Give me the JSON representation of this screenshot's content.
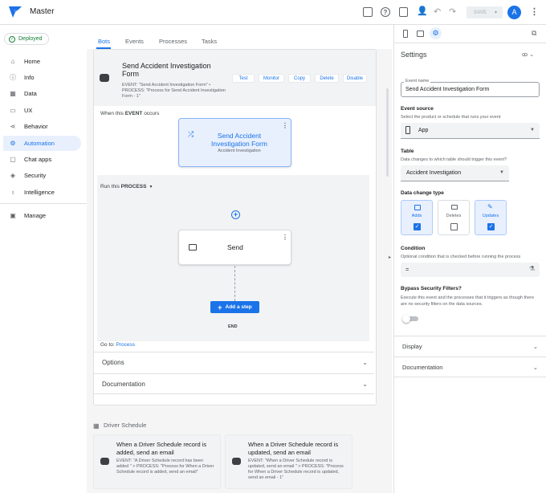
{
  "app": {
    "title": "Master",
    "save_label": "SAVE",
    "avatar_letter": "A"
  },
  "sidebar": {
    "deployed_label": "Deployed",
    "items": [
      {
        "label": "Home",
        "icon": "home-icon"
      },
      {
        "label": "Info",
        "icon": "info-icon"
      },
      {
        "label": "Data",
        "icon": "data-icon"
      },
      {
        "label": "UX",
        "icon": "ux-icon"
      },
      {
        "label": "Behavior",
        "icon": "behavior-icon"
      },
      {
        "label": "Automation",
        "icon": "automation-icon"
      },
      {
        "label": "Chat apps",
        "icon": "chat-icon"
      },
      {
        "label": "Security",
        "icon": "shield-icon"
      },
      {
        "label": "Intelligence",
        "icon": "bulb-icon"
      },
      {
        "label": "Manage",
        "icon": "grid-icon"
      }
    ],
    "active_index": 5
  },
  "tabs": [
    "Bots",
    "Events",
    "Processes",
    "Tasks"
  ],
  "bot": {
    "title": "Send Accident Investigation Form",
    "description": "EVENT: \"Send Accident Investigation Form\" • PROCESS: \"Process for Send Accident Investigation Form - 1\"",
    "actions": [
      "Test",
      "Monitor",
      "Copy",
      "Delete",
      "Disable"
    ],
    "event_prefix": "When this ",
    "event_word": "EVENT",
    "event_suffix": " occurs",
    "event_node": {
      "title": "Send Accident Investigation Form",
      "subtitle": "Accident Investigation"
    },
    "process_prefix": "Run this ",
    "process_word": "PROCESS",
    "send_label": "Send",
    "add_step_label": "Add a step",
    "end_label": "END",
    "goto_prefix": "Go to: ",
    "goto_link": "Process",
    "options_label": "Options",
    "documentation_label": "Documentation"
  },
  "driver_schedule": {
    "heading": "Driver Schedule",
    "cards": [
      {
        "title": "When a Driver Schedule record is added, send an email",
        "desc": "EVENT: \"A Driver Schedule record has been added \" > PROCESS: \"Process for When a Driver Schedule record is added, send an email\""
      },
      {
        "title": "When a Driver Schedule record is updated, send an email",
        "desc": "EVENT: \"When a Driver Schedule record is updated, send an email \" > PROCESS: \"Process for When a Driver Schedule record is updated, send an email - 1\""
      }
    ]
  },
  "settings": {
    "title": "Settings",
    "event_name_label": "Event name",
    "event_name_value": "Send Accident Investigation Form",
    "event_source_label": "Event source",
    "event_source_desc": "Select the product or schedule that runs your event",
    "event_source_value": "App",
    "table_label": "Table",
    "table_desc": "Data changes to which table should trigger this event?",
    "table_value": "Accident Investigation",
    "data_change_label": "Data change type",
    "change_types": [
      {
        "label": "Adds",
        "checked": true
      },
      {
        "label": "Deletes",
        "checked": false
      },
      {
        "label": "Updates",
        "checked": true
      }
    ],
    "condition_label": "Condition",
    "condition_desc": "Optional condition that is checked before running the process",
    "condition_value": "=",
    "bypass_label": "Bypass Security Filters?",
    "bypass_desc": "Execute this event and the processes that it triggers as though there are no security filters on the data sources.",
    "display_label": "Display",
    "documentation_label": "Documentation"
  },
  "colors": {
    "accent": "#1a73e8",
    "deployed": "#188038"
  }
}
